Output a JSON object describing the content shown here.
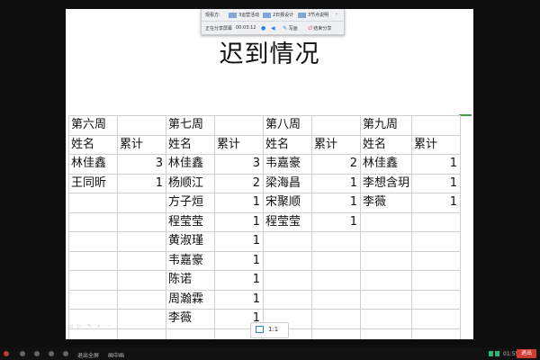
{
  "share_bar": {
    "label": "观看方:",
    "thumbs": [
      "3运营活动",
      "2日报设计",
      "3节点说明"
    ],
    "status": "正在分享屏幕",
    "timer": "00:03:12",
    "annotate": "写画",
    "stop": "结束分享"
  },
  "slide": {
    "title": "迟到情况",
    "week_row": [
      "第六周",
      "",
      "第七周",
      "",
      "第八周",
      "",
      "第九周",
      ""
    ],
    "header_row": [
      "姓名",
      "累计",
      "姓名",
      "累计",
      "姓名",
      "累计",
      "姓名",
      "累计"
    ],
    "rows": [
      [
        "林佳鑫",
        "3",
        "林佳鑫",
        "3",
        "韦嘉豪",
        "2",
        "林佳鑫",
        "1"
      ],
      [
        "王同昕",
        "1",
        "杨顺江",
        "2",
        "梁海昌",
        "1",
        "李想含玥",
        "1"
      ],
      [
        "",
        "",
        "方子烜",
        "1",
        "宋聚顺",
        "1",
        "李薇",
        "1"
      ],
      [
        "",
        "",
        "程莹莹",
        "1",
        "程莹莹",
        "1",
        "",
        ""
      ],
      [
        "",
        "",
        "黄淑瑾",
        "1",
        "",
        "",
        "",
        ""
      ],
      [
        "",
        "",
        "韦嘉豪",
        "1",
        "",
        "",
        "",
        ""
      ],
      [
        "",
        "",
        "陈诺",
        "1",
        "",
        "",
        "",
        ""
      ],
      [
        "",
        "",
        "周瀚霖",
        "1",
        "",
        "",
        "",
        ""
      ],
      [
        "",
        "",
        "李薇",
        "1",
        "",
        "",
        "",
        ""
      ],
      [
        "",
        "",
        "",
        "",
        "",
        "",
        "",
        ""
      ]
    ]
  },
  "zoom": {
    "label": "1:1"
  },
  "taskbar": {
    "exit_fullscreen": "退出全屏",
    "popout": "画中画",
    "time": "01:55",
    "exit": "退出"
  }
}
